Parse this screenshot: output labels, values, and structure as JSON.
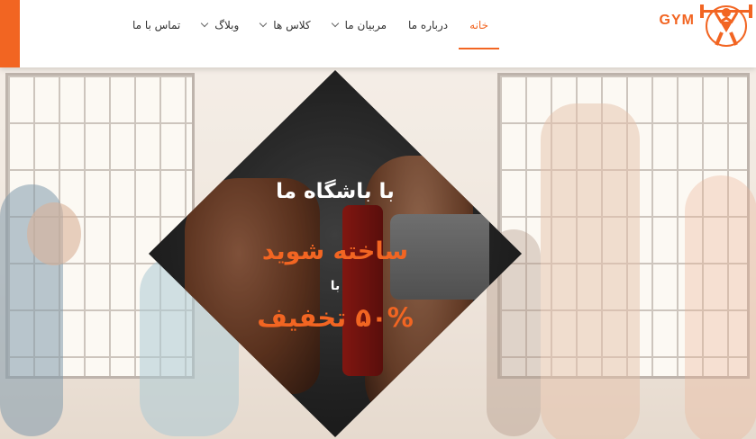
{
  "brand": {
    "logo_text": "GYM",
    "accent": "#f26522"
  },
  "nav": {
    "items": [
      {
        "label": "خانه",
        "active": true,
        "dropdown": false
      },
      {
        "label": "درباره ما",
        "active": false,
        "dropdown": false
      },
      {
        "label": "مربیان ما",
        "active": false,
        "dropdown": true
      },
      {
        "label": "کلاس ها",
        "active": false,
        "dropdown": true
      },
      {
        "label": "وبلاگ",
        "active": false,
        "dropdown": true
      },
      {
        "label": "تماس با ما",
        "active": false,
        "dropdown": false
      }
    ]
  },
  "hero": {
    "line1": "با باشگاه ما",
    "line2": "ساخته شوید",
    "line3": "با",
    "line4": "۵۰% تخفیف"
  }
}
